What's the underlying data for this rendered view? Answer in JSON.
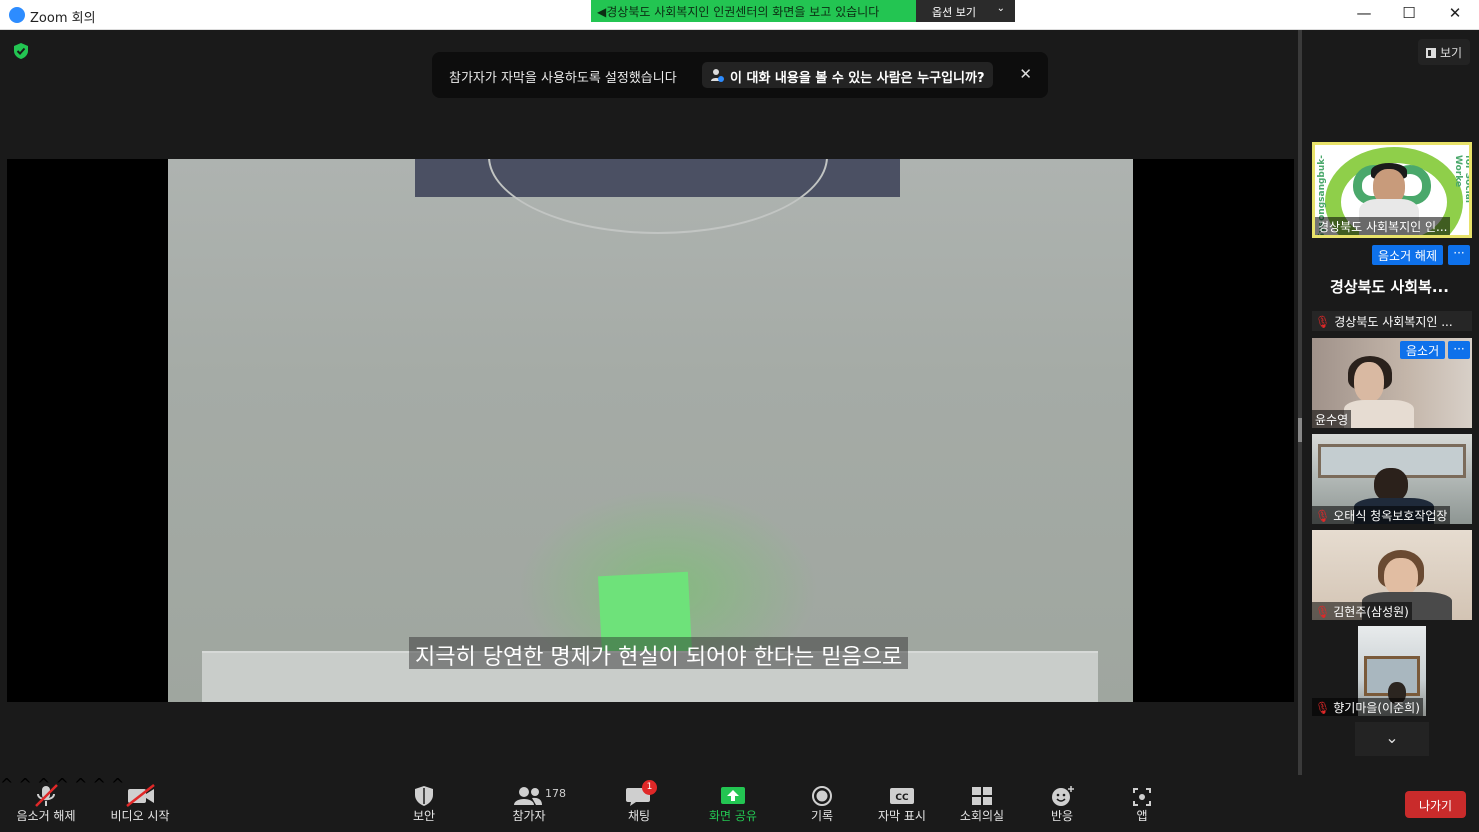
{
  "window": {
    "title": "Zoom 회의",
    "controls": {
      "minimize": "—",
      "maximize": "☐",
      "close": "✕"
    }
  },
  "share_banner": {
    "text": "경상북도 사회복지인 인권센터의 화면을 보고 있습니다",
    "options_label": "옵션 보기",
    "options_caret": "⌄"
  },
  "caption_notice": {
    "text": "참가자가 자막을 사용하도록 설정했습니다",
    "who_can_see": "이 대화 내용을 볼 수 있는 사람은 누구입니까?",
    "close": "✕"
  },
  "shared_video": {
    "subtitle": "지극히 당연한 명제가 현실이 되어야 한다는 믿음으로"
  },
  "sidebar": {
    "view_label": "보기",
    "active_speaker": {
      "name": "경상북도 사회복지인 인...",
      "logo_left_text": "Gyeongsangbuk-",
      "logo_right_text": "for Social Worke",
      "unmute_button": "음소거 해제",
      "more_button": "···"
    },
    "heading": "경상북도 사회복...",
    "namebar": "경상북도 사회복지인 ...",
    "participants": [
      {
        "name": "윤수영",
        "muted": false,
        "mute_button": "음소거",
        "more_button": "···"
      },
      {
        "name": "오태식 청옥보호작업장",
        "muted": true
      },
      {
        "name": "김현주(삼성원)",
        "muted": true
      },
      {
        "name": "향기마을(이준희)",
        "muted": true
      }
    ],
    "scroll_down": "⌄"
  },
  "toolbar": {
    "unmute": "음소거 해제",
    "start_video": "비디오 시작",
    "security": "보안",
    "participants": "참가자",
    "participants_count": "178",
    "chat": "채팅",
    "chat_badge": "1",
    "share_screen": "화면 공유",
    "record": "기록",
    "captions": "자막 표시",
    "cc_text": "CC",
    "breakout": "소회의실",
    "reactions": "반응",
    "apps": "앱",
    "leave": "나가기",
    "caret": "^"
  },
  "colors": {
    "share_green": "#23c552",
    "zoom_blue": "#0e71eb",
    "leave_red": "#c92b2b",
    "speaker_highlight": "#e8e26a"
  }
}
